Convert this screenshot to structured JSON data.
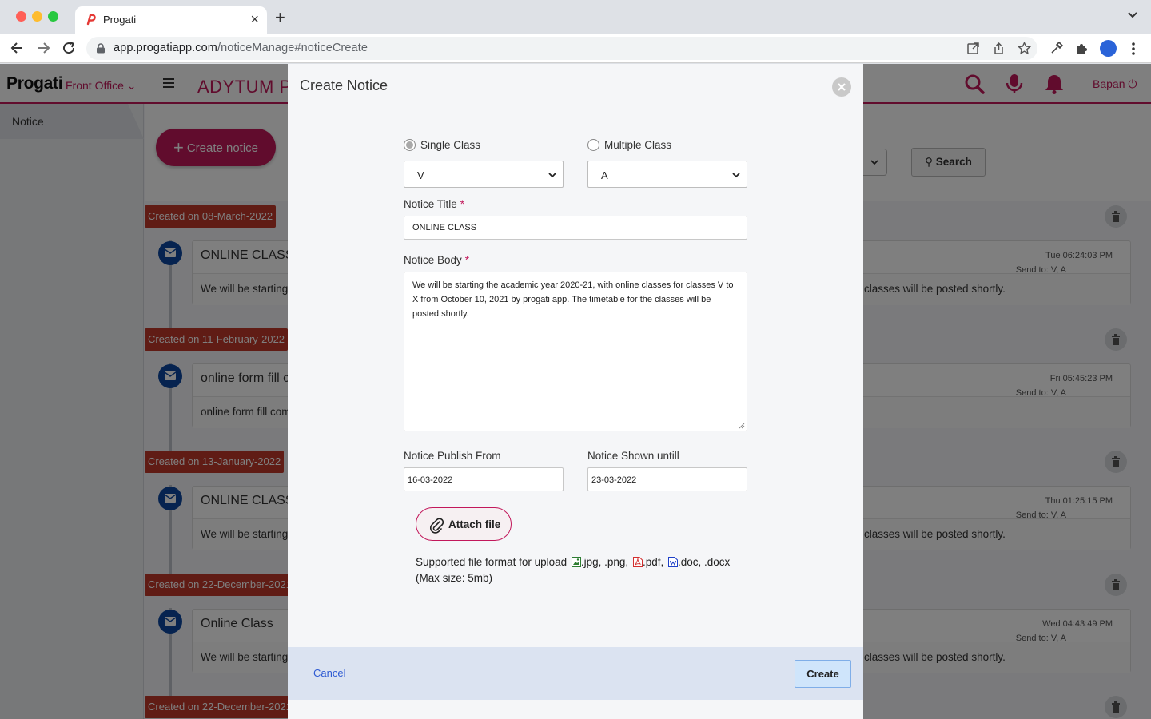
{
  "browser": {
    "tab_title": "Progati",
    "url_host": "app.progatiapp.com",
    "url_path": "/noticeManage#noticeCreate"
  },
  "app": {
    "brand": "Progati",
    "module": "Front Office",
    "school_name": "ADYTUM PU",
    "user_name": "Bapan",
    "sidebar": {
      "items": [
        {
          "label": "Notice"
        }
      ]
    },
    "create_button": "Create notice",
    "search_button": "Search",
    "notices": [
      {
        "date": "Created on 08-March-2022",
        "title": "ONLINE CLASS",
        "body_start": "We will be starting",
        "body_end": "classes will be posted shortly.",
        "time": "Tue 06:24:03 PM",
        "send_to": "Send to: V, A"
      },
      {
        "date": "Created on 11-February-2022",
        "title": "online form fill c",
        "body_start": "online form fill com",
        "body_end": "",
        "time": "Fri 05:45:23 PM",
        "send_to": "Send to: V, A"
      },
      {
        "date": "Created on 13-January-2022",
        "title": "ONLINE CLASS",
        "body_start": "We will be starting",
        "body_end": "classes will be posted shortly.",
        "time": "Thu 01:25:15 PM",
        "send_to": "Send to: V, A"
      },
      {
        "date": "Created on 22-December-2021",
        "title": "Online Class",
        "body_start": "We will be starting",
        "body_end": "classes will be posted shortly.",
        "time": "Wed 04:43:49 PM",
        "send_to": "Send to: V, A"
      },
      {
        "date": "Created on 22-December-2021"
      }
    ]
  },
  "modal": {
    "title": "Create Notice",
    "single_class_label": "Single Class",
    "multiple_class_label": "Multiple Class",
    "class_value": "V",
    "section_value": "A",
    "notice_title_label": "Notice Title",
    "notice_title_value": "ONLINE CLASS",
    "notice_body_label": "Notice Body",
    "notice_body_value": "We will be starting the academic year 2020-21, with online classes for classes V to X from October 10, 2021 by progati app. The timetable for the classes will be posted shortly.",
    "publish_from_label": "Notice Publish From",
    "publish_from_value": "16-03-2022",
    "shown_until_label": "Notice Shown untill",
    "shown_until_value": "23-03-2022",
    "attach_label": "Attach file",
    "supported_prefix": "Supported file format for upload",
    "fmt_images": ".jpg, .png,",
    "fmt_pdf": ".pdf,",
    "fmt_doc": ".doc, .docx",
    "max_size": "(Max size: 5mb)",
    "cancel_label": "Cancel",
    "create_label": "Create"
  },
  "colors": {
    "brand_magenta": "#c2185b",
    "badge_red": "#c0392b",
    "mail_blue": "#0d47a1",
    "footer_blue": "#dbe3f1"
  }
}
